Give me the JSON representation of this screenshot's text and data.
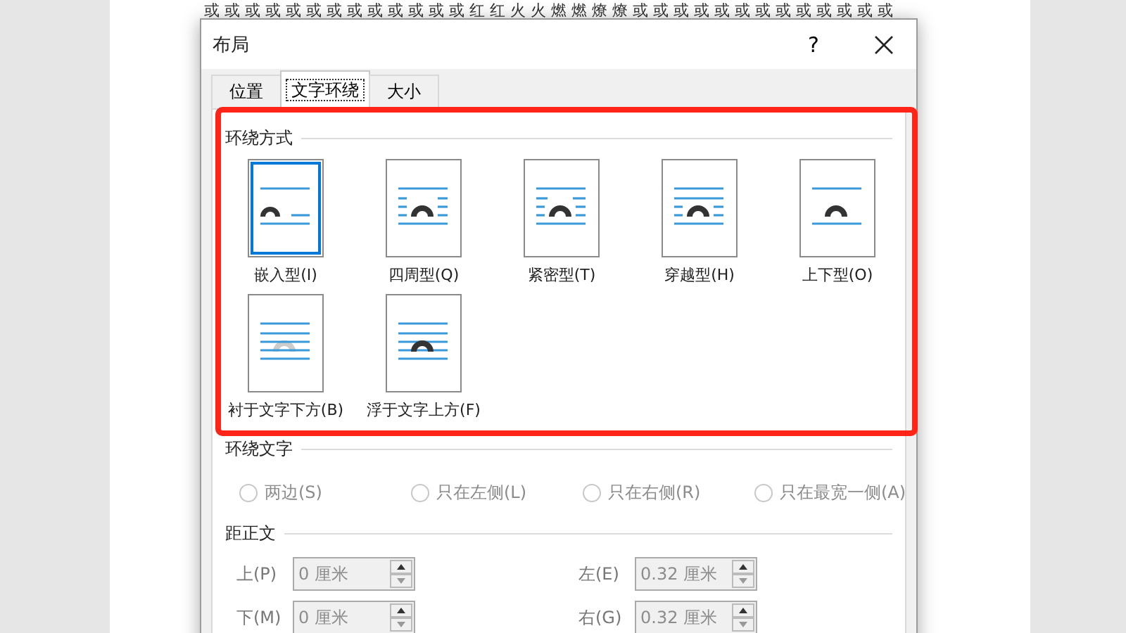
{
  "document": {
    "text": "或或或或或或或或或或或或或红红火火燃燃燎燎或或或或或或或或或或或或或"
  },
  "dialog": {
    "title": "布局",
    "help": "?"
  },
  "tabs": [
    {
      "label": "位置",
      "selected": false
    },
    {
      "label": "文字环绕",
      "selected": true
    },
    {
      "label": "大小",
      "selected": false
    }
  ],
  "wrap_styles": {
    "heading": "环绕方式",
    "items": [
      {
        "kind": "inline",
        "label": "嵌入型(I)",
        "selected": true
      },
      {
        "kind": "square",
        "label": "四周型(Q)",
        "selected": false
      },
      {
        "kind": "tight",
        "label": "紧密型(T)",
        "selected": false
      },
      {
        "kind": "through",
        "label": "穿越型(H)",
        "selected": false
      },
      {
        "kind": "topbottom",
        "label": "上下型(O)",
        "selected": false
      },
      {
        "kind": "behind",
        "label": "衬于文字下方(B)",
        "selected": false
      },
      {
        "kind": "front",
        "label": "浮于文字上方(F)",
        "selected": false
      }
    ]
  },
  "wrap_text": {
    "heading": "环绕文字",
    "options": [
      {
        "label": "两边(S)",
        "selected": false,
        "disabled": true
      },
      {
        "label": "只在左侧(L)",
        "selected": false,
        "disabled": true
      },
      {
        "label": "只在右侧(R)",
        "selected": false,
        "disabled": true
      },
      {
        "label": "只在最宽一侧(A)",
        "selected": false,
        "disabled": true
      }
    ]
  },
  "distance": {
    "heading": "距正文",
    "fields": [
      {
        "label": "上(P)",
        "value": "0 厘米",
        "disabled": true
      },
      {
        "label": "左(E)",
        "value": "0.32 厘米",
        "disabled": true
      },
      {
        "label": "下(M)",
        "value": "0 厘米",
        "disabled": true
      },
      {
        "label": "右(G)",
        "value": "0.32 厘米",
        "disabled": true
      }
    ]
  }
}
